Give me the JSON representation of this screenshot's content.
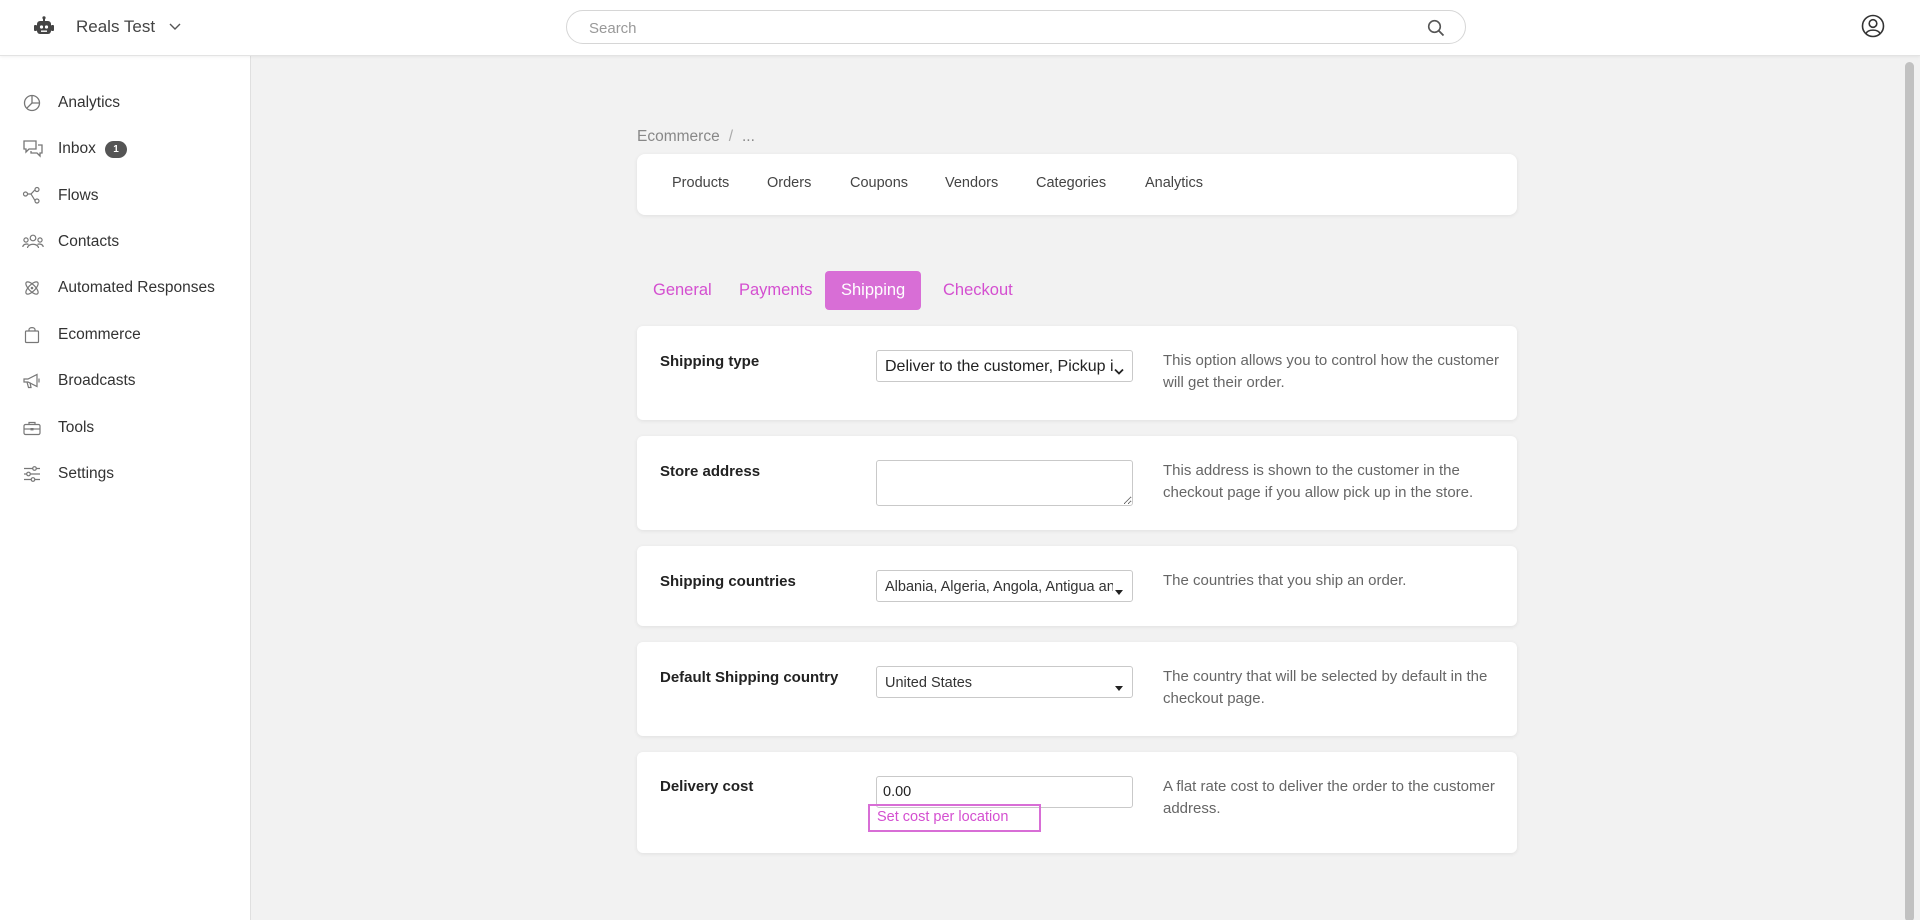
{
  "header": {
    "workspace_name": "Reals Test",
    "search_placeholder": "Search"
  },
  "sidebar": {
    "items": [
      {
        "label": "Analytics",
        "icon": "analytics-icon"
      },
      {
        "label": "Inbox",
        "icon": "inbox-icon",
        "badge": "1"
      },
      {
        "label": "Flows",
        "icon": "flows-icon"
      },
      {
        "label": "Contacts",
        "icon": "contacts-icon"
      },
      {
        "label": "Automated Responses",
        "icon": "automated-responses-icon"
      },
      {
        "label": "Ecommerce",
        "icon": "ecommerce-icon"
      },
      {
        "label": "Broadcasts",
        "icon": "broadcasts-icon"
      },
      {
        "label": "Tools",
        "icon": "tools-icon"
      },
      {
        "label": "Settings",
        "icon": "settings-icon"
      }
    ]
  },
  "breadcrumb": {
    "root": "Ecommerce",
    "separator": "/",
    "current": "..."
  },
  "subnav": {
    "items": [
      "Products",
      "Orders",
      "Coupons",
      "Vendors",
      "Categories",
      "Analytics"
    ]
  },
  "tabs": {
    "items": [
      "General",
      "Payments",
      "Shipping",
      "Checkout"
    ],
    "active": "Shipping"
  },
  "settings": {
    "shipping_type": {
      "label": "Shipping type",
      "value": "Deliver to the customer, Pickup in the store",
      "description": "This option allows you to control how the customer will get their order."
    },
    "store_address": {
      "label": "Store address",
      "value": "",
      "description": "This address is shown to the customer in the checkout page if you allow pick up in the store."
    },
    "shipping_countries": {
      "label": "Shipping countries",
      "value": "Albania, Algeria, Angola, Antigua and Barbuda",
      "description": "The countries that you ship an order."
    },
    "default_country": {
      "label": "Default Shipping country",
      "value": "United States",
      "description": "The country that will be selected by default in the checkout page."
    },
    "delivery_cost": {
      "label": "Delivery cost",
      "value": "0.00",
      "link": "Set cost per location",
      "description": "A flat rate cost to deliver the order to the customer address."
    }
  },
  "colors": {
    "accent": "#d86ed6",
    "accent_text": "#d44fd0",
    "badge": "#555555"
  }
}
